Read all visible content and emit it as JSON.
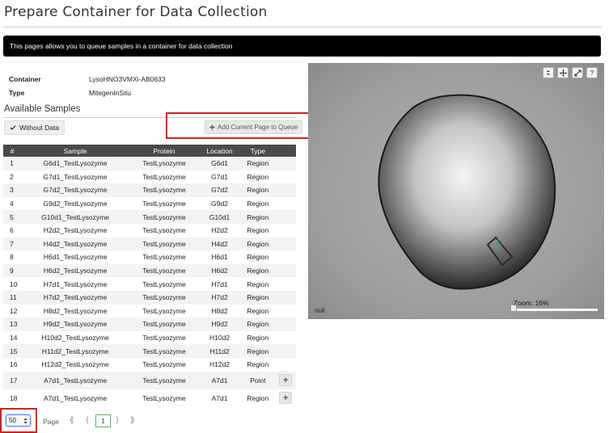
{
  "page": {
    "title": "Prepare Container for Data Collection",
    "banner": "This pages allows you to queue samples in a container for data collection"
  },
  "container_info": {
    "container_label": "Container",
    "container_value": "LysoHNO3VMXi-AB0633",
    "type_label": "Type",
    "type_value": "MitegenInSitu"
  },
  "samples_section": {
    "title": "Available Samples",
    "without_data_label": "Without Data",
    "add_page_label": "Add Current Page to Queue",
    "columns": [
      "#",
      "Sample",
      "Protein",
      "Location",
      "Type"
    ],
    "rows": [
      {
        "num": "1",
        "sample": "G6d1_TestLysozyme",
        "protein": "TestLysozyme",
        "location": "G6d1",
        "type": "Region",
        "action": ""
      },
      {
        "num": "2",
        "sample": "G7d1_TestLysozyme",
        "protein": "TestLysozyme",
        "location": "G7d1",
        "type": "Region",
        "action": ""
      },
      {
        "num": "3",
        "sample": "G7d2_TestLysozyme",
        "protein": "TestLysozyme",
        "location": "G7d2",
        "type": "Region",
        "action": ""
      },
      {
        "num": "4",
        "sample": "G9d2_TestLysozyme",
        "protein": "TestLysozyme",
        "location": "G9d2",
        "type": "Region",
        "action": ""
      },
      {
        "num": "5",
        "sample": "G10d1_TestLysozyme",
        "protein": "TestLysozyme",
        "location": "G10d1",
        "type": "Region",
        "action": ""
      },
      {
        "num": "6",
        "sample": "H2d2_TestLysozyme",
        "protein": "TestLysozyme",
        "location": "H2d2",
        "type": "Region",
        "action": ""
      },
      {
        "num": "7",
        "sample": "H4d2_TestLysozyme",
        "protein": "TestLysozyme",
        "location": "H4d2",
        "type": "Region",
        "action": ""
      },
      {
        "num": "8",
        "sample": "H6d1_TestLysozyme",
        "protein": "TestLysozyme",
        "location": "H6d1",
        "type": "Region",
        "action": ""
      },
      {
        "num": "9",
        "sample": "H6d2_TestLysozyme",
        "protein": "TestLysozyme",
        "location": "H6d2",
        "type": "Region",
        "action": ""
      },
      {
        "num": "10",
        "sample": "H7d1_TestLysozyme",
        "protein": "TestLysozyme",
        "location": "H7d1",
        "type": "Region",
        "action": ""
      },
      {
        "num": "11",
        "sample": "H7d2_TestLysozyme",
        "protein": "TestLysozyme",
        "location": "H7d2",
        "type": "Region",
        "action": ""
      },
      {
        "num": "12",
        "sample": "H8d2_TestLysozyme",
        "protein": "TestLysozyme",
        "location": "H8d2",
        "type": "Region",
        "action": ""
      },
      {
        "num": "13",
        "sample": "H9d2_TestLysozyme",
        "protein": "TestLysozyme",
        "location": "H9d2",
        "type": "Region",
        "action": ""
      },
      {
        "num": "14",
        "sample": "H10d2_TestLysozyme",
        "protein": "TestLysozyme",
        "location": "H10d2",
        "type": "Region",
        "action": ""
      },
      {
        "num": "15",
        "sample": "H11d2_TestLysozyme",
        "protein": "TestLysozyme",
        "location": "H11d2",
        "type": "Region",
        "action": ""
      },
      {
        "num": "16",
        "sample": "H12d2_TestLysozyme",
        "protein": "TestLysozyme",
        "location": "H12d2",
        "type": "Region",
        "action": ""
      },
      {
        "num": "17",
        "sample": "A7d1_TestLysozyme",
        "protein": "TestLysozyme",
        "location": "A7d1",
        "type": "Point",
        "action": "+"
      },
      {
        "num": "18",
        "sample": "A7d1_TestLysozyme",
        "protein": "TestLysozyme",
        "location": "A7d1",
        "type": "Region",
        "action": "+"
      }
    ]
  },
  "pagination": {
    "page_size": "50",
    "page_label": "Page",
    "current_page": "1",
    "first_icon": "⟪",
    "prev_icon": "⟨",
    "next_icon": "⟩",
    "last_icon": "⟫"
  },
  "viewer": {
    "null_text": "null",
    "zoom_label": "Zoom: 16%",
    "zoom_level_percent": 16,
    "tools": [
      "select-arrows-icon",
      "move-icon",
      "fullscreen-icon",
      "help-icon"
    ],
    "help_glyph": "?"
  },
  "colors": {
    "highlight": "#d42020",
    "banner_bg": "#000000",
    "table_header_bg": "#4a4a4a",
    "active_page_border": "#5cb85c"
  }
}
